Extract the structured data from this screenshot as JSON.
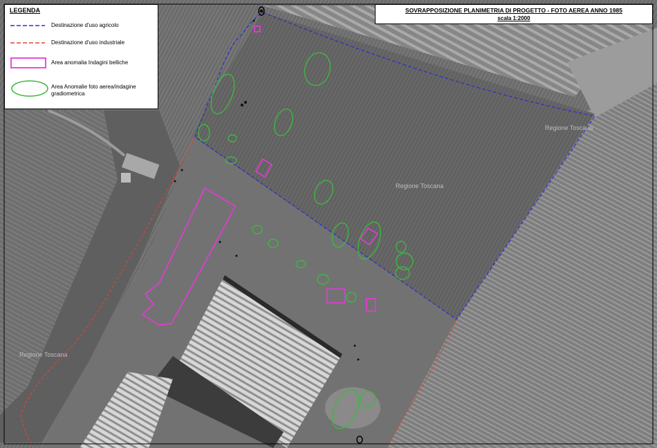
{
  "legend": {
    "title": "LEGENDA",
    "items": [
      {
        "label": "Destinazione d'uso agricolo",
        "style": "dashed-line",
        "color": "#2b2bd6"
      },
      {
        "label": "Destinazione d'uso industriale",
        "style": "dashed-line",
        "color": "#d9463a"
      },
      {
        "label": "Area anomalia Indagini belliche",
        "style": "rectangle",
        "color": "#e63ad9"
      },
      {
        "label": "Area Anomalie foto aerea/indagine gradiometrica",
        "style": "ellipse",
        "color": "#3db83d"
      }
    ]
  },
  "title": {
    "main": "SOVRAPPOSIZIONE PLANIMETRIA DI PROGETTO - FOTO AEREA ANNO 1985",
    "scale": "scala 1:2000"
  },
  "photo_labels": [
    "Regione Toscana",
    "Regione Toscana",
    "Regione Toscana"
  ],
  "colors": {
    "agricultural": "#2b2bd6",
    "industrial": "#d9463a",
    "war_anomaly": "#e63ad9",
    "gradiometric_anomaly": "#3db83d"
  }
}
